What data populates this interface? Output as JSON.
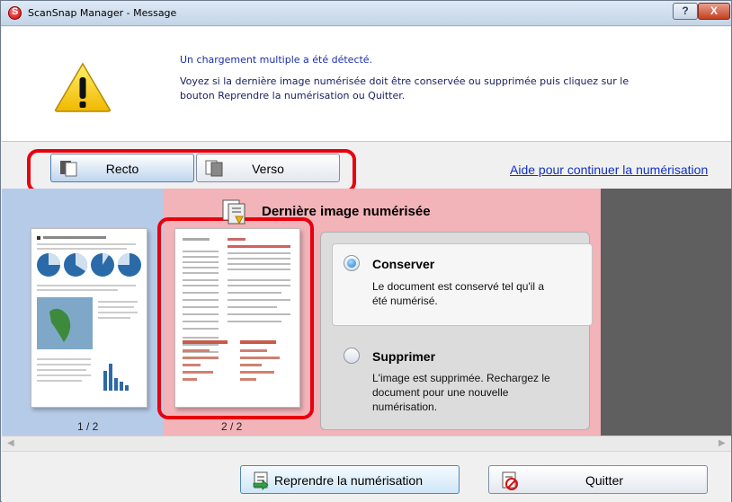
{
  "window": {
    "title": "ScanSnap Manager - Message",
    "help_label": "?",
    "close_label": "X"
  },
  "message": {
    "headline": "Un chargement multiple a été détecté.",
    "body": "Voyez si la dernière image numérisée doit être conservée ou supprimée puis cliquez sur le bouton Reprendre la numérisation ou Quitter."
  },
  "toolbar": {
    "recto_label": "Recto",
    "verso_label": "Verso",
    "help_link": "Aide pour continuer la numérisation"
  },
  "images": {
    "last_title": "Dernière image numérisée",
    "pages": [
      {
        "label": "1 / 2"
      },
      {
        "label": "2 / 2"
      }
    ]
  },
  "options": {
    "keep": {
      "title": "Conserver",
      "description": "Le document est conservé tel qu'il a été numérisé.",
      "selected": true
    },
    "delete": {
      "title": "Supprimer",
      "description": "L'image est supprimée. Rechargez le document pour une nouvelle numérisation.",
      "selected": false
    }
  },
  "footer": {
    "resume_label": "Reprendre la numérisation",
    "quit_label": "Quitter"
  },
  "colors": {
    "accent": "#e8000d",
    "link": "#1030c8",
    "blue_col": "#b6cbe7",
    "pink_col": "#f2b3b9"
  }
}
